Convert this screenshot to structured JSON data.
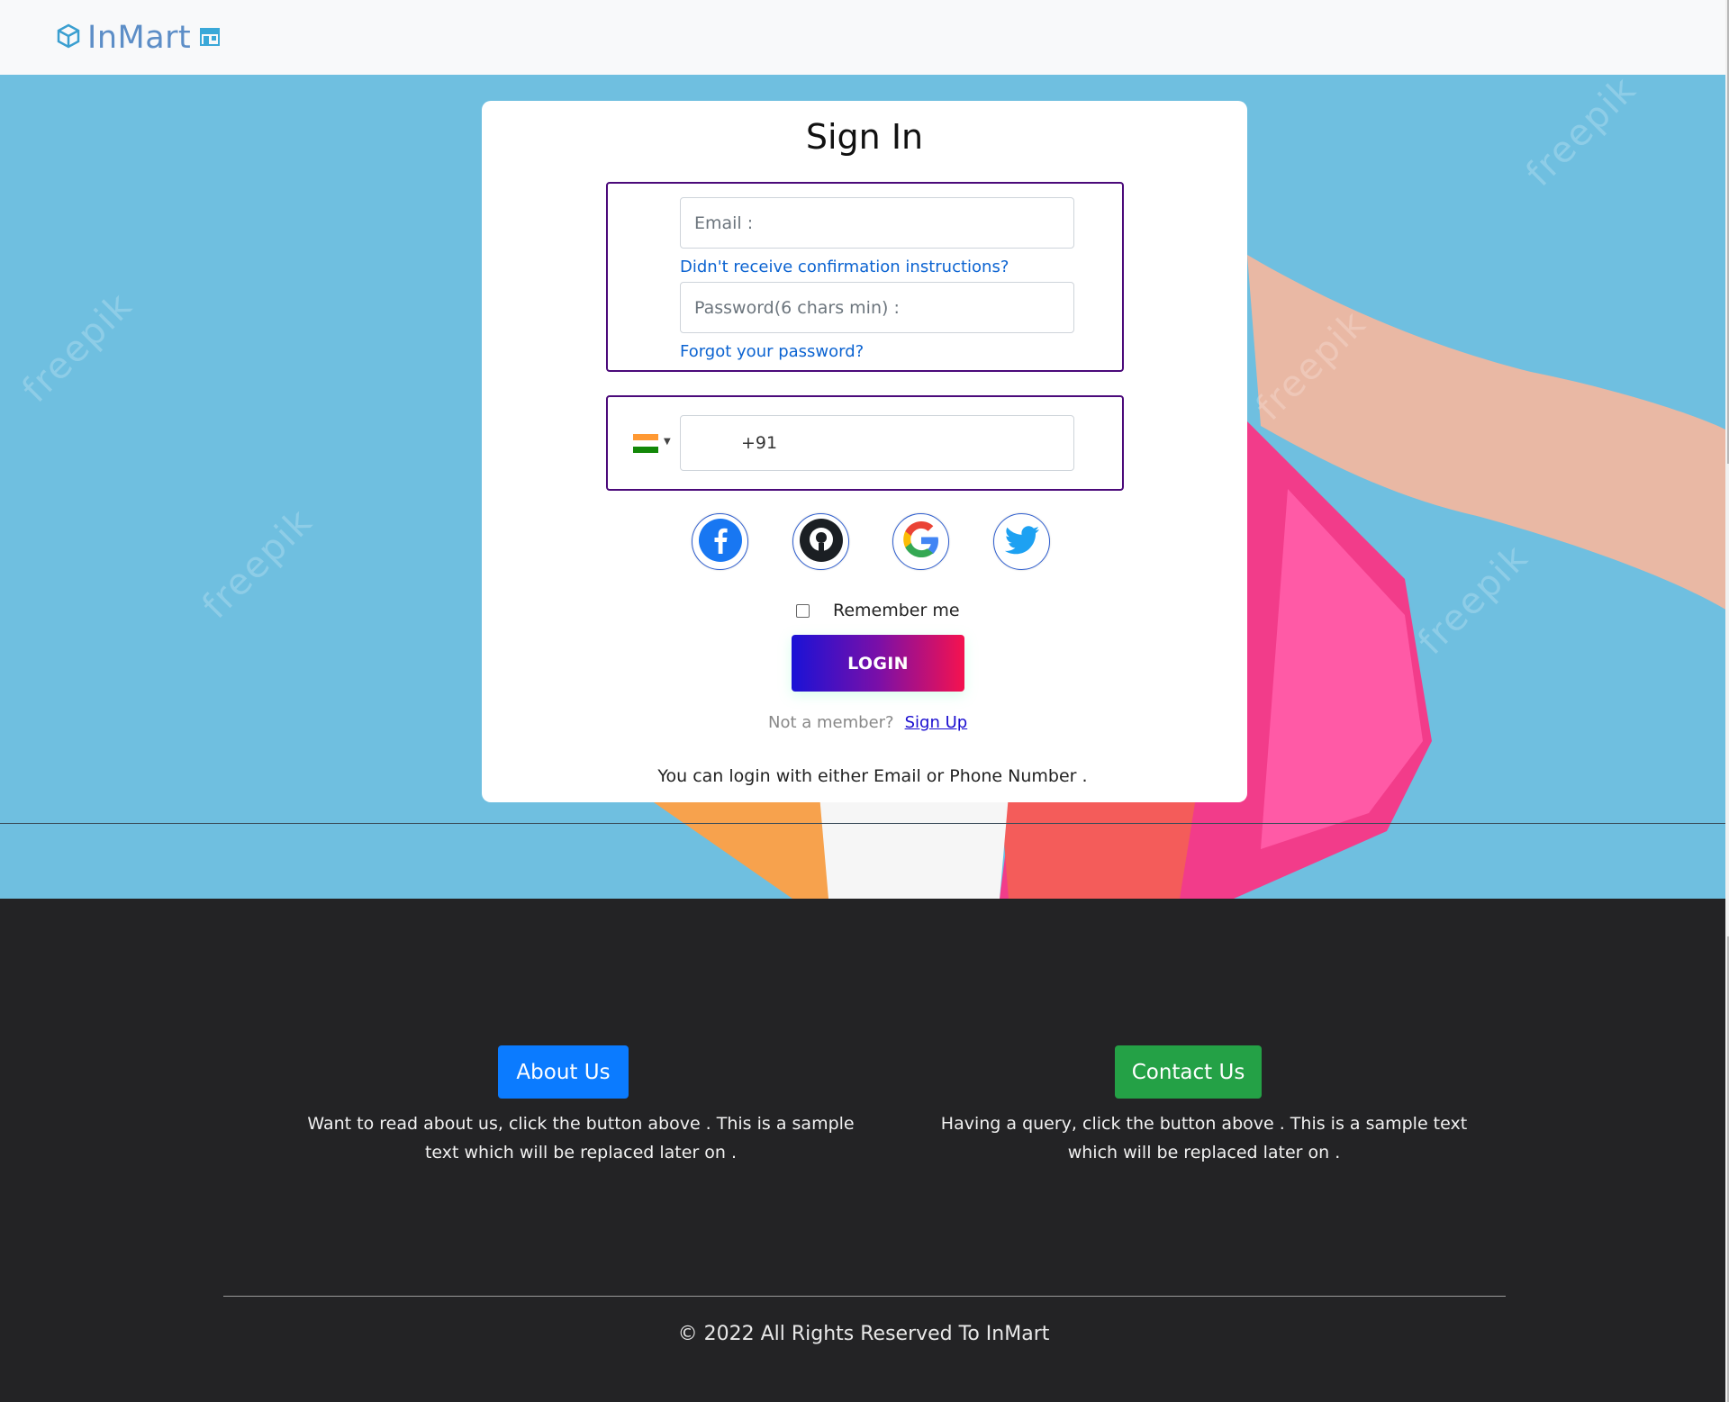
{
  "navbar": {
    "brand": "InMart",
    "brand_color": "#5d8ec7"
  },
  "hero": {
    "watermark": "freepik"
  },
  "signin": {
    "title": "Sign In",
    "email_placeholder": "Email :",
    "confirm_link": "Didn't receive confirmation instructions?",
    "password_placeholder": "Password(6 chars min) :",
    "forgot_link": "Forgot your password?",
    "phone_value": "+91",
    "country_flag_icon": "india-flag-icon",
    "social": [
      {
        "name": "facebook-icon"
      },
      {
        "name": "github-icon"
      },
      {
        "name": "google-icon"
      },
      {
        "name": "twitter-icon"
      }
    ],
    "remember_label": "Remember me",
    "login_label": "LOGIN",
    "not_member": "Not a member?",
    "signup_label": "Sign Up",
    "helper_text": "You can login with either Email or Phone Number ."
  },
  "footer": {
    "about_button": "About Us",
    "about_text": "Want to read about us, click the button above . This is a sample text which will be replaced later on .",
    "contact_button": "Contact Us",
    "contact_text": "Having a query, click the button above . This is a sample text which will be replaced later on .",
    "copyright": "© 2022 All Rights Reserved To InMart",
    "about_color": "#0b7bff",
    "contact_color": "#24a146"
  }
}
